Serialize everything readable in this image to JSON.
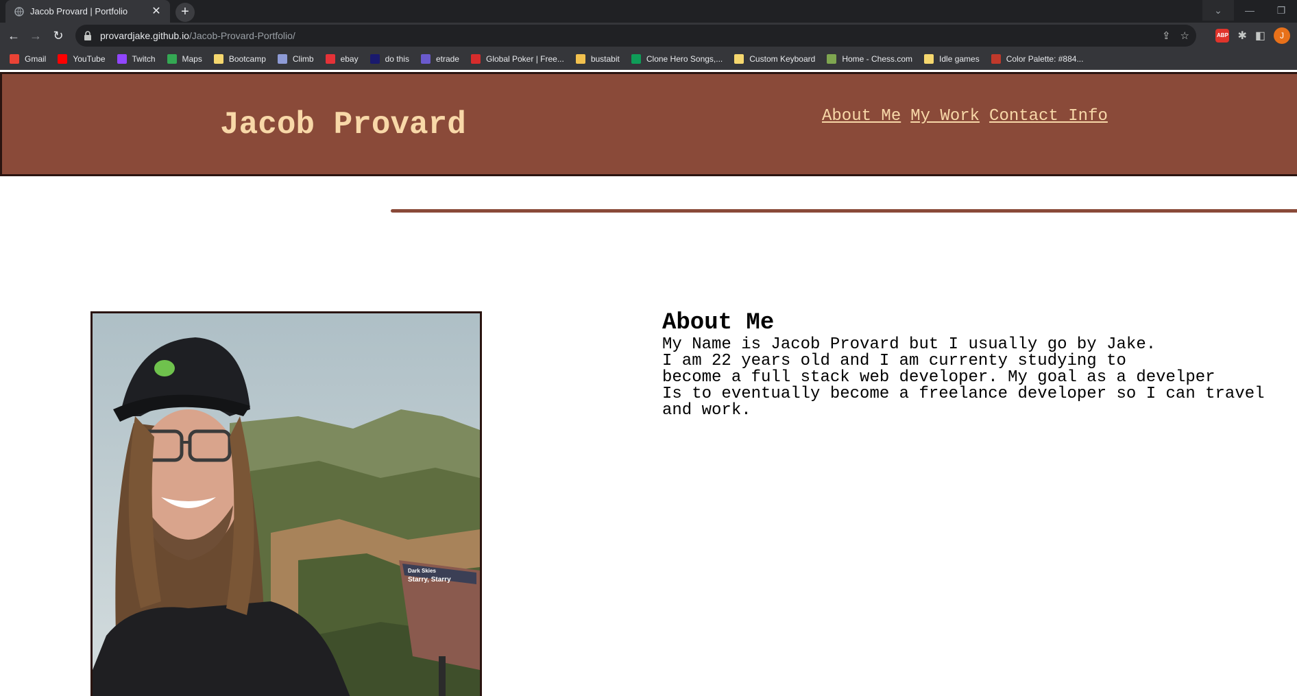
{
  "browser": {
    "tab_title": "Jacob Provard | Portfolio",
    "url_host": "provardjake.github.io",
    "url_path": "/Jacob-Provard-Portfolio/",
    "profile_initial": "J",
    "adblock_label": "ABP",
    "bookmarks": [
      {
        "label": "Gmail",
        "icon": "gmail-icon",
        "color": "#ea4335"
      },
      {
        "label": "YouTube",
        "icon": "youtube-icon",
        "color": "#ff0000"
      },
      {
        "label": "Twitch",
        "icon": "twitch-icon",
        "color": "#9146ff"
      },
      {
        "label": "Maps",
        "icon": "maps-icon",
        "color": "#34a853"
      },
      {
        "label": "Bootcamp",
        "icon": "folder-icon",
        "color": "#f5d76e"
      },
      {
        "label": "Climb",
        "icon": "climb-icon",
        "color": "#8e9bd6"
      },
      {
        "label": "ebay",
        "icon": "ebay-icon",
        "color": "#e53238"
      },
      {
        "label": "do this",
        "icon": "dothis-icon",
        "color": "#1a1a6e"
      },
      {
        "label": "etrade",
        "icon": "etrade-icon",
        "color": "#6a5acd"
      },
      {
        "label": "Global Poker | Free...",
        "icon": "poker-icon",
        "color": "#d62c2c"
      },
      {
        "label": "bustabit",
        "icon": "bustabit-icon",
        "color": "#f2c14e"
      },
      {
        "label": "Clone Hero Songs,...",
        "icon": "sheets-icon",
        "color": "#0f9d58"
      },
      {
        "label": "Custom Keyboard",
        "icon": "folder-icon",
        "color": "#f5d76e"
      },
      {
        "label": "Home - Chess.com",
        "icon": "chess-icon",
        "color": "#7fa650"
      },
      {
        "label": "Idle games",
        "icon": "folder-icon",
        "color": "#f5d76e"
      },
      {
        "label": "Color Palette: #884...",
        "icon": "palette-icon",
        "color": "#c0392b"
      }
    ]
  },
  "site": {
    "title": "Jacob Provard",
    "nav": [
      "About Me",
      "My Work",
      "Contact Info"
    ],
    "about": {
      "heading": "About Me",
      "lines": [
        "My Name is Jacob Provard but I usually go by Jake.",
        "I am 22 years old and I am currenty studying to",
        "become a full stack web developer. My goal as a develper",
        "Is to eventually become a freelance developer so I can travel",
        "and work."
      ]
    },
    "sign_text": [
      "Dark Skies",
      "Starry, Starry"
    ]
  },
  "colors": {
    "header_bg": "#8a4a39",
    "header_text": "#f8d8a8",
    "border": "#2a1410"
  }
}
